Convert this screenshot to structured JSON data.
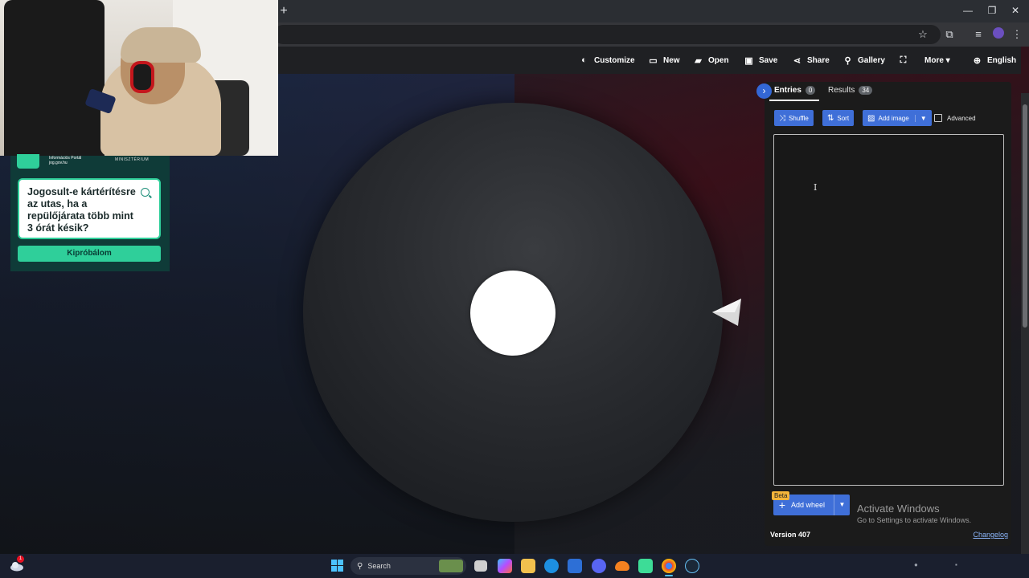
{
  "browser": {
    "new_tab": "+",
    "window_controls": [
      "—",
      "❐",
      "✕"
    ],
    "toolbar_icons": [
      "☆",
      "⧉",
      "≡",
      "⋮"
    ]
  },
  "appbar": {
    "items": [
      {
        "icon": "◐",
        "label": "Customize"
      },
      {
        "icon": "▭",
        "label": "New"
      },
      {
        "icon": "▰",
        "label": "Open"
      },
      {
        "icon": "▣",
        "label": "Save"
      },
      {
        "icon": "⋖",
        "label": "Share"
      },
      {
        "icon": "⚲",
        "label": "Gallery"
      },
      {
        "icon": "⛶",
        "label": ""
      },
      {
        "icon": "",
        "label": "More ▾"
      },
      {
        "icon": "⊕",
        "label": "English"
      }
    ]
  },
  "panel": {
    "collapse_icon": "›",
    "tab_entries": "Entries",
    "entries_count": "0",
    "tab_results": "Results",
    "results_count": "34",
    "shuffle": "Shuffle",
    "sort": "Sort",
    "add_image": "Add image",
    "advanced": "Advanced",
    "beta": "Beta",
    "add_wheel": "Add wheel",
    "version": "Version 407",
    "changelog": "Changelog"
  },
  "activation": {
    "title": "Activate Windows",
    "subtitle": "Go to Settings to activate Windows."
  },
  "ad": {
    "portal_line1": "Információs Portál",
    "portal_line2": "jog.gov.hu",
    "ministry": "MINISZTÉRIUM",
    "question": "Jogosult-e kártérítésre az utas, ha a repülőjárata több mint 3 órát késik?",
    "button": "Kipróbálom"
  },
  "taskbar": {
    "notification_count": "1",
    "search_placeholder": "Search"
  },
  "colors": {
    "accent": "#3f6fd8",
    "ad_green": "#2fcf9a",
    "beta": "#f5b53a"
  }
}
